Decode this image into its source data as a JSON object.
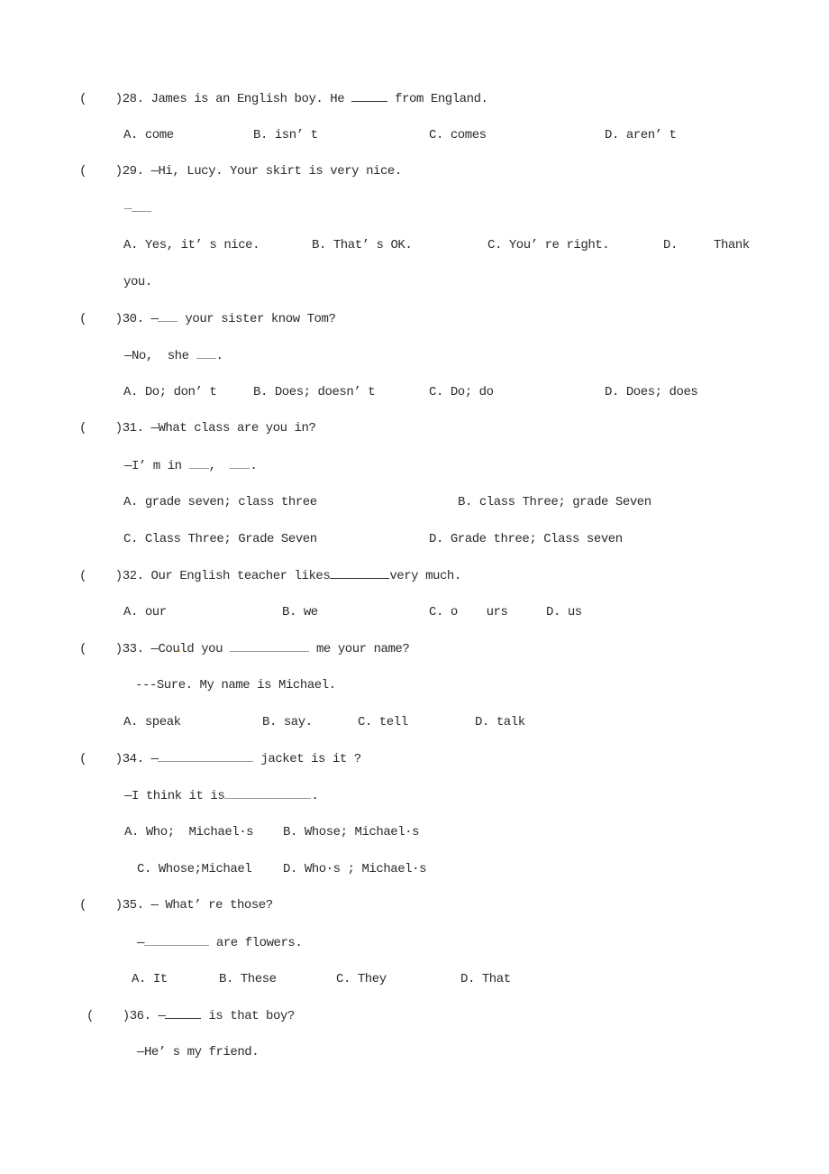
{
  "questions": [
    {
      "number": "28",
      "bracket": "(    )",
      "stem_before": "28. James is an English boy. He ",
      "stem_after": " from England.",
      "options": {
        "A": "A. come",
        "B": "B. isn’ t",
        "C": "C. comes",
        "D": "D. aren’ t"
      }
    },
    {
      "number": "29",
      "bracket": "(    )",
      "stem": "29. —Hi, Lucy. Your skirt is very nice.",
      "response_prefix": "—",
      "options": {
        "A": "A. Yes, it’ s nice.",
        "B": "B. That’ s OK.",
        "C": "C. You’ re right.",
        "D_label": "D.",
        "D_text": "Thank",
        "D_cont": "you."
      }
    },
    {
      "number": "30",
      "bracket": "(    )",
      "stem_before": "30. —",
      "stem_after": " your sister know Tom?",
      "response_before": "—No,  she ",
      "response_after": ".",
      "options": {
        "A": "A. Do; don’ t",
        "B": "B. Does; doesn’ t",
        "C": "C. Do; do",
        "D": "D. Does; does"
      }
    },
    {
      "number": "31",
      "bracket": "(    )",
      "stem": "31. —What class are you in?",
      "response_before": "—I’ m in ",
      "response_mid": ",  ",
      "response_after": ".",
      "options": {
        "A": "A. grade seven; class three",
        "B": "B. class Three; grade Seven",
        "C": "C. Class Three; Grade Seven",
        "D": "D. Grade three; Class seven"
      }
    },
    {
      "number": "32",
      "bracket": "(    )",
      "stem_before": "32. Our English teacher likes",
      "stem_after": "very much.",
      "options": {
        "A": "A. our",
        "B": "B. we",
        "C": "C. o    urs",
        "D": "D. us"
      }
    },
    {
      "number": "33",
      "bracket": "(    )",
      "stem_before": "33. —Cou",
      "stem_mid": "ld you ",
      "stem_after": " me your name?",
      "response": "---Sure. My name is Michael.",
      "options": {
        "A": "A. speak",
        "B": "B. say.",
        "C": "C. tell",
        "D": "D. talk"
      }
    },
    {
      "number": "34",
      "bracket": "(    )",
      "stem_before": "34. —",
      "stem_after": " jacket is it ?",
      "response_before": "—I think it is",
      "response_after": ".",
      "options": {
        "A": "A. Who;  Michael·s",
        "B": "B. Whose; Michael·s",
        "C": "C. Whose;Michael",
        "D": "D. Who·s ; Michael·s"
      }
    },
    {
      "number": "35",
      "bracket": "(    )",
      "stem": "35. — What’ re those?",
      "response_before": "—",
      "response_after": " are flowers.",
      "options": {
        "A": "A. It",
        "B": "B. These",
        "C": "C. They",
        "D": "D. That"
      }
    },
    {
      "number": "36",
      "bracket": "(    )",
      "stem_before": "36. —",
      "stem_after": " is that boy?",
      "response": "—He’ s my friend."
    }
  ]
}
